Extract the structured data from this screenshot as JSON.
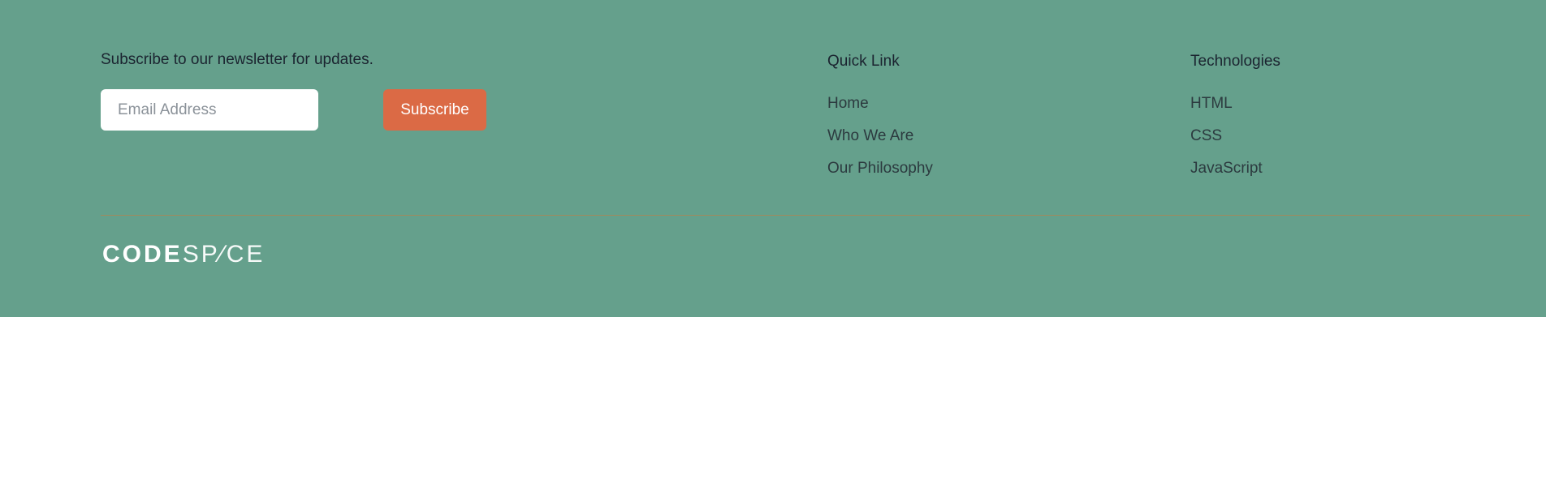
{
  "newsletter": {
    "title": "Subscribe to our newsletter for updates.",
    "email_placeholder": "Email Address",
    "email_value": "",
    "subscribe_label": "Subscribe"
  },
  "quick_links": {
    "title": "Quick Link",
    "items": [
      "Home",
      "Who We Are",
      "Our Philosophy"
    ]
  },
  "technologies": {
    "title": "Technologies",
    "items": [
      "HTML",
      "CSS",
      "JavaScript"
    ]
  },
  "logo": {
    "text_bold": "CODE",
    "text_light": "SP∕CE"
  },
  "colors": {
    "footer_background": "#65a08c",
    "button_accent": "#db6a45",
    "divider": "#a08a5e"
  }
}
